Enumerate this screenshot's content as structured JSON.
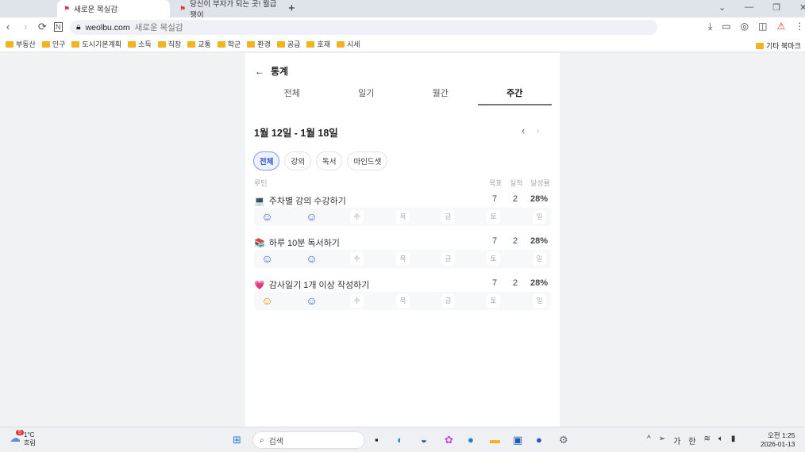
{
  "browser": {
    "tabs": [
      {
        "label": "새로운 목실감"
      },
      {
        "label": "당신이 부자가 되는 곳! 월급쟁이"
      }
    ],
    "new_tab": "+",
    "domain": "weolbu.com",
    "page_title": "새로운 목실감",
    "bookmarks": [
      "부동산",
      "인구",
      "도시기본계획",
      "소득",
      "직장",
      "교통",
      "학군",
      "환경",
      "공급",
      "호재",
      "시세"
    ],
    "other_bookmarks": "기타 북마크"
  },
  "page": {
    "title": "통계",
    "tabs": [
      "전체",
      "일기",
      "월간",
      "주간"
    ],
    "active_tab": 3,
    "range": "1월 12일 - 1월 18일",
    "filters": [
      "전체",
      "강의",
      "독서",
      "마인드셋"
    ],
    "active_filter": 0,
    "headers": {
      "routine": "루틴",
      "goal": "목표",
      "actual": "실적",
      "rate": "달성률"
    },
    "routines": [
      {
        "icon": "laptop-icon",
        "emoji": "💻",
        "name": "주차별 강의 수강하기",
        "goal": "7",
        "actual": "2",
        "rate": "28%",
        "days": [
          {
            "state": "done",
            "color": "#3b5bdb"
          },
          {
            "state": "done",
            "color": "#3b5bdb"
          },
          {
            "label": "수"
          },
          {
            "label": "목"
          },
          {
            "label": "금"
          },
          {
            "label": "토"
          },
          {
            "label": "일"
          }
        ]
      },
      {
        "icon": "books-icon",
        "emoji": "📚",
        "name": "하루 10분 독서하기",
        "goal": "7",
        "actual": "2",
        "rate": "28%",
        "days": [
          {
            "state": "done",
            "color": "#3b5bdb"
          },
          {
            "state": "done",
            "color": "#3b5bdb"
          },
          {
            "label": "수"
          },
          {
            "label": "목"
          },
          {
            "label": "금"
          },
          {
            "label": "토"
          },
          {
            "label": "일"
          }
        ]
      },
      {
        "icon": "heart-icon",
        "emoji": "💗",
        "name": "감사일기 1개 이상 작성하기",
        "goal": "7",
        "actual": "2",
        "rate": "28%",
        "days": [
          {
            "state": "partial",
            "color": "#f08c00"
          },
          {
            "state": "done",
            "color": "#3b5bdb"
          },
          {
            "label": "수"
          },
          {
            "label": "목"
          },
          {
            "label": "금"
          },
          {
            "label": "토"
          },
          {
            "label": "일"
          }
        ]
      }
    ]
  },
  "taskbar": {
    "weather_temp": "1°C",
    "weather_desc": "흐림",
    "weather_badge": "5",
    "search": "검색",
    "ime1": "가",
    "ime2": "한",
    "time": "오전 1:25",
    "date": "2026-01-13"
  }
}
